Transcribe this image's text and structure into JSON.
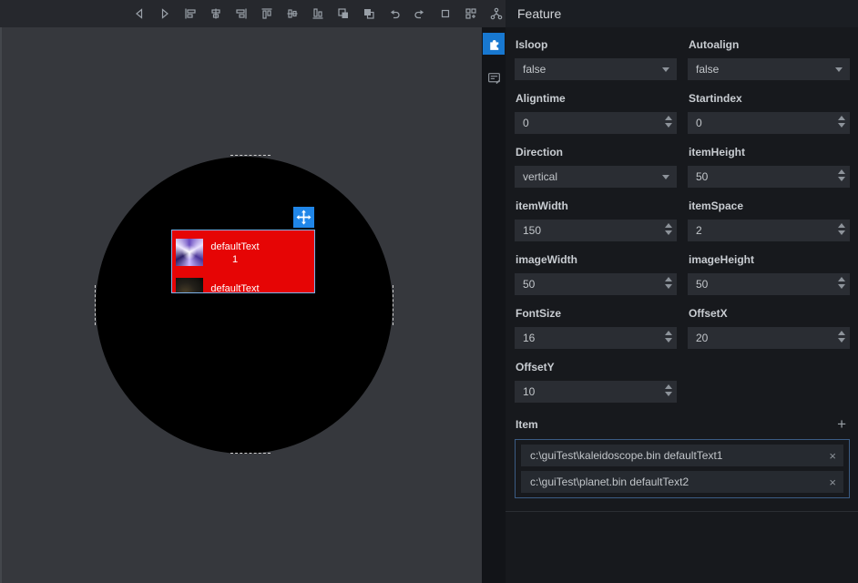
{
  "toolbar": {
    "icons": [
      {
        "name": "nav-back"
      },
      {
        "name": "nav-forward"
      },
      {
        "name": "align-left"
      },
      {
        "name": "align-center-horizontal"
      },
      {
        "name": "align-right"
      },
      {
        "name": "align-top"
      },
      {
        "name": "align-middle-vertical"
      },
      {
        "name": "align-bottom"
      },
      {
        "name": "bring-forward"
      },
      {
        "name": "send-backward"
      },
      {
        "name": "undo"
      },
      {
        "name": "redo"
      },
      {
        "name": "stop"
      },
      {
        "name": "snap-grid"
      },
      {
        "name": "hierarchy"
      }
    ]
  },
  "sidebar": {
    "tabs": [
      {
        "name": "widgets",
        "icon": "puzzle-icon",
        "active": true
      },
      {
        "name": "properties",
        "icon": "property-editor-icon",
        "active": false
      }
    ]
  },
  "panel": {
    "title": "Feature",
    "fields": [
      {
        "label": "Isloop",
        "value": "false",
        "type": "dropdown"
      },
      {
        "label": "Autoalign",
        "value": "false",
        "type": "dropdown"
      },
      {
        "label": "Aligntime",
        "value": "0",
        "type": "spinner"
      },
      {
        "label": "Startindex",
        "value": "0",
        "type": "spinner"
      },
      {
        "label": "Direction",
        "value": "vertical",
        "type": "dropdown"
      },
      {
        "label": "itemHeight",
        "value": "50",
        "type": "spinner"
      },
      {
        "label": "itemWidth",
        "value": "150",
        "type": "spinner"
      },
      {
        "label": "itemSpace",
        "value": "2",
        "type": "spinner"
      },
      {
        "label": "imageWidth",
        "value": "50",
        "type": "spinner"
      },
      {
        "label": "imageHeight",
        "value": "50",
        "type": "spinner"
      },
      {
        "label": "FontSize",
        "value": "16",
        "type": "spinner"
      },
      {
        "label": "OffsetX",
        "value": "20",
        "type": "spinner"
      },
      {
        "label": "OffsetY",
        "value": "10",
        "type": "spinner"
      }
    ],
    "item_section": {
      "label": "Item",
      "add_button": "+",
      "remove_label": "×",
      "items": [
        {
          "text": "c:\\guiTest\\kaleidoscope.bin defaultText1"
        },
        {
          "text": "c:\\guiTest\\planet.bin defaultText2"
        }
      ]
    }
  },
  "canvas": {
    "list_widget": {
      "items": [
        {
          "line1": "defaultText",
          "line2": "1"
        },
        {
          "line1": "defaultText"
        }
      ]
    },
    "move_handle": {
      "icon": "move-arrows"
    }
  },
  "colors": {
    "accent_blue": "#1878d0",
    "handle_blue": "#2086e8",
    "widget_red": "#e60505",
    "selection_border": "#7db2ea",
    "item_list_border": "#3b5c84"
  }
}
